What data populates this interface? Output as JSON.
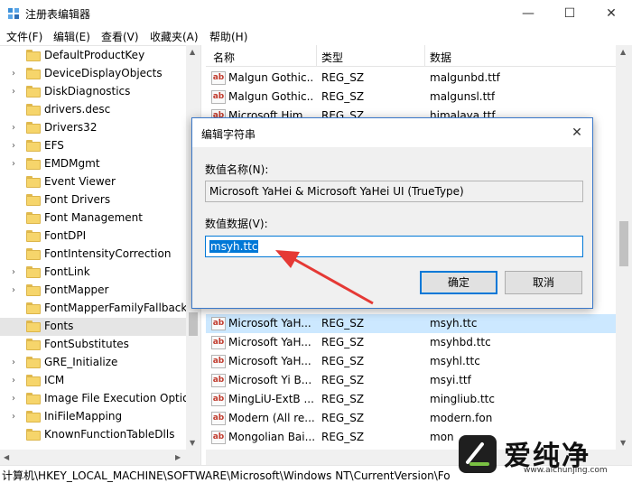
{
  "window": {
    "title": "注册表编辑器",
    "minimize_glyph": "—",
    "maximize_glyph": "☐",
    "close_glyph": "✕"
  },
  "menu": [
    "文件(F)",
    "编辑(E)",
    "查看(V)",
    "收藏夹(A)",
    "帮助(H)"
  ],
  "tree": {
    "items": [
      {
        "label": "DefaultProductKey",
        "expandable": false
      },
      {
        "label": "DeviceDisplayObjects",
        "expandable": true
      },
      {
        "label": "DiskDiagnostics",
        "expandable": true
      },
      {
        "label": "drivers.desc",
        "expandable": false
      },
      {
        "label": "Drivers32",
        "expandable": true
      },
      {
        "label": "EFS",
        "expandable": true
      },
      {
        "label": "EMDMgmt",
        "expandable": true
      },
      {
        "label": "Event Viewer",
        "expandable": false
      },
      {
        "label": "Font Drivers",
        "expandable": false
      },
      {
        "label": "Font Management",
        "expandable": false
      },
      {
        "label": "FontDPI",
        "expandable": false
      },
      {
        "label": "FontIntensityCorrection",
        "expandable": false
      },
      {
        "label": "FontLink",
        "expandable": true
      },
      {
        "label": "FontMapper",
        "expandable": true
      },
      {
        "label": "FontMapperFamilyFallback",
        "expandable": false
      },
      {
        "label": "Fonts",
        "expandable": false,
        "selected": true
      },
      {
        "label": "FontSubstitutes",
        "expandable": false
      },
      {
        "label": "GRE_Initialize",
        "expandable": true
      },
      {
        "label": "ICM",
        "expandable": true
      },
      {
        "label": "Image File Execution Optio",
        "expandable": true
      },
      {
        "label": "IniFileMapping",
        "expandable": true
      },
      {
        "label": "KnownFunctionTableDlls",
        "expandable": false
      }
    ]
  },
  "list": {
    "columns": [
      "名称",
      "类型",
      "数据"
    ],
    "rows_top": [
      {
        "name": "Malgun Gothic...",
        "type": "REG_SZ",
        "data": "malgunbd.ttf"
      },
      {
        "name": "Malgun Gothic...",
        "type": "REG_SZ",
        "data": "malgunsl.ttf"
      },
      {
        "name": "Microsoft Him...",
        "type": "REG_SZ",
        "data": "himalaya.ttf"
      }
    ],
    "rows_bottom": [
      {
        "name": "Microsoft YaH...",
        "type": "REG_SZ",
        "data": "msyh.ttc",
        "selected": true
      },
      {
        "name": "Microsoft YaH...",
        "type": "REG_SZ",
        "data": "msyhbd.ttc"
      },
      {
        "name": "Microsoft YaH...",
        "type": "REG_SZ",
        "data": "msyhl.ttc"
      },
      {
        "name": "Microsoft Yi B...",
        "type": "REG_SZ",
        "data": "msyi.ttf"
      },
      {
        "name": "MingLiU-ExtB ...",
        "type": "REG_SZ",
        "data": "mingliub.ttc"
      },
      {
        "name": "Modern (All re...",
        "type": "REG_SZ",
        "data": "modern.fon"
      },
      {
        "name": "Mongolian Bai...",
        "type": "REG_SZ",
        "data": "mon"
      }
    ],
    "icon_text": "ab"
  },
  "statusbar": {
    "path": "计算机\\HKEY_LOCAL_MACHINE\\SOFTWARE\\Microsoft\\Windows NT\\CurrentVersion\\Fo"
  },
  "dialog": {
    "title": "编辑字符串",
    "close_glyph": "✕",
    "name_label": "数值名称(N):",
    "name_value": "Microsoft YaHei & Microsoft YaHei UI (TrueType)",
    "data_label": "数值数据(V):",
    "data_value": "msyh.ttc",
    "ok_label": "确定",
    "cancel_label": "取消"
  },
  "watermark": {
    "brand": "爱纯净",
    "url": "www.aichunjing.com"
  },
  "colors": {
    "selection_blue": "#0078d7",
    "annotation_red": "#e53935",
    "folder_yellow": "#f6d56b"
  }
}
